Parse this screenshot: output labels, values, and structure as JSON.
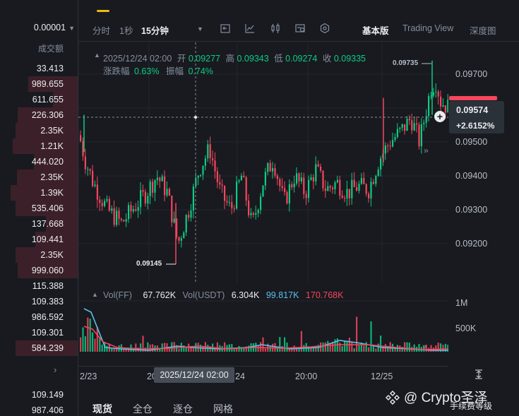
{
  "orderbook": {
    "precision": "0.00001",
    "column_header": "成交额",
    "asks": [
      "33.413",
      "989.655",
      "611.655",
      "226.306",
      "2.35K",
      "1.21K",
      "444.020",
      "2.35K",
      "1.39K",
      "535.406",
      "137.668",
      "109.441",
      "2.35K",
      "999.060"
    ],
    "bids": [
      "115.388",
      "109.383",
      "986.592",
      "109.301",
      "584.239"
    ],
    "tail": [
      "109.149",
      "987.406"
    ],
    "expand_glyph": "›"
  },
  "toolbar": {
    "items": [
      "分时",
      "1秒",
      "15分钟"
    ],
    "right": [
      "基本版",
      "Trading View",
      "深度图"
    ],
    "icons": [
      "indicator-icon",
      "chart-style-icon",
      "candle-type-icon",
      "draw-tool-icon",
      "settings-icon"
    ]
  },
  "chart": {
    "info": {
      "datetime": "2025/12/24 02:00",
      "open_label": "开",
      "open": "0.09277",
      "high_label": "高",
      "high": "0.09343",
      "low_label": "低",
      "low": "0.09274",
      "close_label": "收",
      "close": "0.09335",
      "change_label": "涨跌幅",
      "change": "0.63%",
      "amplitude_label": "振幅",
      "amplitude": "0.74%"
    },
    "price_axis": [
      "0.09700",
      "0.09500",
      "0.09400",
      "0.09300",
      "0.09200"
    ],
    "current_price": "0.09574",
    "current_change": "+2.6152%",
    "high_marker": "0.09735",
    "low_marker": "0.09145"
  },
  "volume": {
    "label_ff": "Vol(FF)",
    "ff": "67.762K",
    "label_usdt": "Vol(USDT)",
    "usdt": "6.304K",
    "ma1": "99.817K",
    "ma2": "170.768K",
    "axis": [
      "1M",
      "500K"
    ]
  },
  "time_axis": {
    "labels": [
      "2/23",
      "20",
      "24",
      "20:00",
      "12/25"
    ],
    "crosshair": "2025/12/24 02:00"
  },
  "bottom_tabs": [
    "现货",
    "全仓",
    "逐仓",
    "网格"
  ],
  "fee_level": "手续费等级",
  "watermark": "@ Crypto圣泽",
  "colors": {
    "up": "#0ecb81",
    "down": "#f6465d",
    "accent": "#f0b90b",
    "bg": "#181a20"
  }
}
